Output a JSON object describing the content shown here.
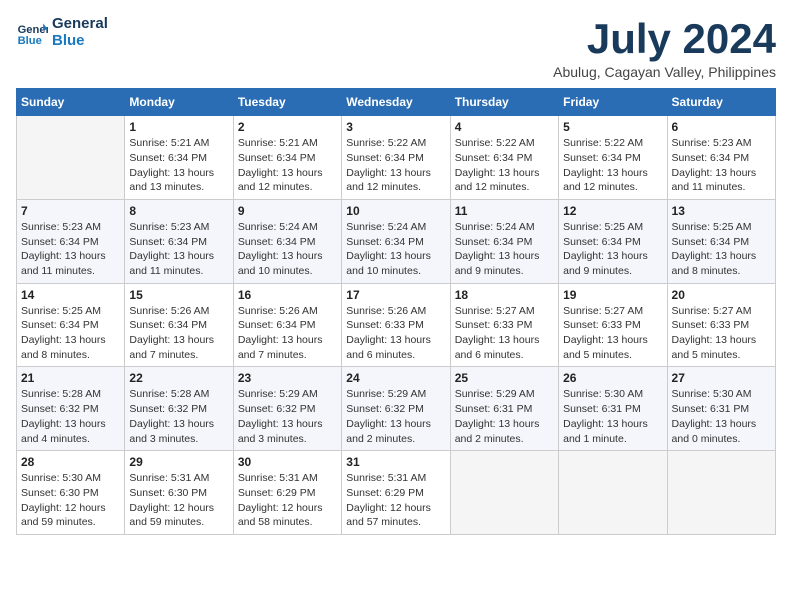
{
  "logo": {
    "line1": "General",
    "line2": "Blue"
  },
  "title": "July 2024",
  "location": "Abulug, Cagayan Valley, Philippines",
  "days_header": [
    "Sunday",
    "Monday",
    "Tuesday",
    "Wednesday",
    "Thursday",
    "Friday",
    "Saturday"
  ],
  "weeks": [
    [
      {
        "num": "",
        "sunrise": "",
        "sunset": "",
        "daylight": ""
      },
      {
        "num": "1",
        "sunrise": "Sunrise: 5:21 AM",
        "sunset": "Sunset: 6:34 PM",
        "daylight": "Daylight: 13 hours and 13 minutes."
      },
      {
        "num": "2",
        "sunrise": "Sunrise: 5:21 AM",
        "sunset": "Sunset: 6:34 PM",
        "daylight": "Daylight: 13 hours and 12 minutes."
      },
      {
        "num": "3",
        "sunrise": "Sunrise: 5:22 AM",
        "sunset": "Sunset: 6:34 PM",
        "daylight": "Daylight: 13 hours and 12 minutes."
      },
      {
        "num": "4",
        "sunrise": "Sunrise: 5:22 AM",
        "sunset": "Sunset: 6:34 PM",
        "daylight": "Daylight: 13 hours and 12 minutes."
      },
      {
        "num": "5",
        "sunrise": "Sunrise: 5:22 AM",
        "sunset": "Sunset: 6:34 PM",
        "daylight": "Daylight: 13 hours and 12 minutes."
      },
      {
        "num": "6",
        "sunrise": "Sunrise: 5:23 AM",
        "sunset": "Sunset: 6:34 PM",
        "daylight": "Daylight: 13 hours and 11 minutes."
      }
    ],
    [
      {
        "num": "7",
        "sunrise": "Sunrise: 5:23 AM",
        "sunset": "Sunset: 6:34 PM",
        "daylight": "Daylight: 13 hours and 11 minutes."
      },
      {
        "num": "8",
        "sunrise": "Sunrise: 5:23 AM",
        "sunset": "Sunset: 6:34 PM",
        "daylight": "Daylight: 13 hours and 11 minutes."
      },
      {
        "num": "9",
        "sunrise": "Sunrise: 5:24 AM",
        "sunset": "Sunset: 6:34 PM",
        "daylight": "Daylight: 13 hours and 10 minutes."
      },
      {
        "num": "10",
        "sunrise": "Sunrise: 5:24 AM",
        "sunset": "Sunset: 6:34 PM",
        "daylight": "Daylight: 13 hours and 10 minutes."
      },
      {
        "num": "11",
        "sunrise": "Sunrise: 5:24 AM",
        "sunset": "Sunset: 6:34 PM",
        "daylight": "Daylight: 13 hours and 9 minutes."
      },
      {
        "num": "12",
        "sunrise": "Sunrise: 5:25 AM",
        "sunset": "Sunset: 6:34 PM",
        "daylight": "Daylight: 13 hours and 9 minutes."
      },
      {
        "num": "13",
        "sunrise": "Sunrise: 5:25 AM",
        "sunset": "Sunset: 6:34 PM",
        "daylight": "Daylight: 13 hours and 8 minutes."
      }
    ],
    [
      {
        "num": "14",
        "sunrise": "Sunrise: 5:25 AM",
        "sunset": "Sunset: 6:34 PM",
        "daylight": "Daylight: 13 hours and 8 minutes."
      },
      {
        "num": "15",
        "sunrise": "Sunrise: 5:26 AM",
        "sunset": "Sunset: 6:34 PM",
        "daylight": "Daylight: 13 hours and 7 minutes."
      },
      {
        "num": "16",
        "sunrise": "Sunrise: 5:26 AM",
        "sunset": "Sunset: 6:34 PM",
        "daylight": "Daylight: 13 hours and 7 minutes."
      },
      {
        "num": "17",
        "sunrise": "Sunrise: 5:26 AM",
        "sunset": "Sunset: 6:33 PM",
        "daylight": "Daylight: 13 hours and 6 minutes."
      },
      {
        "num": "18",
        "sunrise": "Sunrise: 5:27 AM",
        "sunset": "Sunset: 6:33 PM",
        "daylight": "Daylight: 13 hours and 6 minutes."
      },
      {
        "num": "19",
        "sunrise": "Sunrise: 5:27 AM",
        "sunset": "Sunset: 6:33 PM",
        "daylight": "Daylight: 13 hours and 5 minutes."
      },
      {
        "num": "20",
        "sunrise": "Sunrise: 5:27 AM",
        "sunset": "Sunset: 6:33 PM",
        "daylight": "Daylight: 13 hours and 5 minutes."
      }
    ],
    [
      {
        "num": "21",
        "sunrise": "Sunrise: 5:28 AM",
        "sunset": "Sunset: 6:32 PM",
        "daylight": "Daylight: 13 hours and 4 minutes."
      },
      {
        "num": "22",
        "sunrise": "Sunrise: 5:28 AM",
        "sunset": "Sunset: 6:32 PM",
        "daylight": "Daylight: 13 hours and 3 minutes."
      },
      {
        "num": "23",
        "sunrise": "Sunrise: 5:29 AM",
        "sunset": "Sunset: 6:32 PM",
        "daylight": "Daylight: 13 hours and 3 minutes."
      },
      {
        "num": "24",
        "sunrise": "Sunrise: 5:29 AM",
        "sunset": "Sunset: 6:32 PM",
        "daylight": "Daylight: 13 hours and 2 minutes."
      },
      {
        "num": "25",
        "sunrise": "Sunrise: 5:29 AM",
        "sunset": "Sunset: 6:31 PM",
        "daylight": "Daylight: 13 hours and 2 minutes."
      },
      {
        "num": "26",
        "sunrise": "Sunrise: 5:30 AM",
        "sunset": "Sunset: 6:31 PM",
        "daylight": "Daylight: 13 hours and 1 minute."
      },
      {
        "num": "27",
        "sunrise": "Sunrise: 5:30 AM",
        "sunset": "Sunset: 6:31 PM",
        "daylight": "Daylight: 13 hours and 0 minutes."
      }
    ],
    [
      {
        "num": "28",
        "sunrise": "Sunrise: 5:30 AM",
        "sunset": "Sunset: 6:30 PM",
        "daylight": "Daylight: 12 hours and 59 minutes."
      },
      {
        "num": "29",
        "sunrise": "Sunrise: 5:31 AM",
        "sunset": "Sunset: 6:30 PM",
        "daylight": "Daylight: 12 hours and 59 minutes."
      },
      {
        "num": "30",
        "sunrise": "Sunrise: 5:31 AM",
        "sunset": "Sunset: 6:29 PM",
        "daylight": "Daylight: 12 hours and 58 minutes."
      },
      {
        "num": "31",
        "sunrise": "Sunrise: 5:31 AM",
        "sunset": "Sunset: 6:29 PM",
        "daylight": "Daylight: 12 hours and 57 minutes."
      },
      {
        "num": "",
        "sunrise": "",
        "sunset": "",
        "daylight": ""
      },
      {
        "num": "",
        "sunrise": "",
        "sunset": "",
        "daylight": ""
      },
      {
        "num": "",
        "sunrise": "",
        "sunset": "",
        "daylight": ""
      }
    ]
  ]
}
